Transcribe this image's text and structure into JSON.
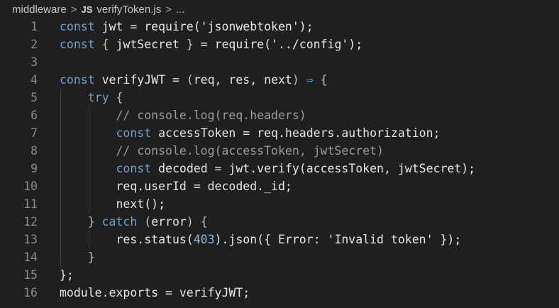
{
  "breadcrumb": {
    "folder": "middleware",
    "file_icon": "JS",
    "file": "verifyToken.js",
    "more": "..."
  },
  "colors": {
    "background": "#1f1f1f",
    "keyword": "#6fa0d0",
    "text": "#e6e6e6",
    "comment": "#9a9a9a",
    "line_number": "#8a8a8a"
  },
  "lines": [
    {
      "n": "1",
      "t": [
        [
          "const",
          "kw"
        ],
        " jwt = require('jsonwebtoken');"
      ]
    },
    {
      "n": "2",
      "t": [
        [
          "const",
          "kw"
        ],
        [
          " { ",
          "pn"
        ],
        "jwtSecret",
        [
          " }",
          "pn"
        ],
        " = require('../config');"
      ]
    },
    {
      "n": "3",
      "t": []
    },
    {
      "n": "4",
      "t": [
        [
          "const",
          "kw"
        ],
        " verifyJWT = ",
        [
          "(",
          "pn"
        ],
        "req, res, next",
        [
          ")",
          "pn"
        ],
        " ",
        [
          "⇒",
          "kw"
        ],
        [
          " {",
          "pn"
        ]
      ]
    },
    {
      "n": "5",
      "t": [
        "    ",
        [
          "try",
          "kw"
        ],
        [
          " {",
          "pn"
        ]
      ]
    },
    {
      "n": "6",
      "t": [
        [
          "        // console.log(req.headers)",
          "cm"
        ]
      ]
    },
    {
      "n": "7",
      "t": [
        "        ",
        [
          "const",
          "kw"
        ],
        " accessToken = req.headers.authorization;"
      ]
    },
    {
      "n": "8",
      "t": [
        [
          "        // console.log(accessToken, jwtSecret)",
          "cm"
        ]
      ]
    },
    {
      "n": "9",
      "t": [
        "        ",
        [
          "const",
          "kw"
        ],
        " decoded = jwt.verify(accessToken, jwtSecret);"
      ]
    },
    {
      "n": "10",
      "t": [
        "        req.userId = decoded._id;"
      ]
    },
    {
      "n": "11",
      "t": [
        "        next();"
      ]
    },
    {
      "n": "12",
      "t": [
        [
          "    }",
          "pn"
        ],
        " ",
        [
          "catch",
          "kw"
        ],
        " ",
        [
          "(",
          "pn"
        ],
        "error",
        [
          ")",
          "pn"
        ],
        [
          " {",
          "pn"
        ]
      ]
    },
    {
      "n": "13",
      "t": [
        "        res.status(",
        [
          "403",
          "num"
        ],
        ").json({ Error: 'Invalid token' });"
      ]
    },
    {
      "n": "14",
      "t": [
        [
          "    }",
          "pn"
        ]
      ]
    },
    {
      "n": "15",
      "t": [
        "};"
      ]
    },
    {
      "n": "16",
      "t": [
        "module.exports = verifyJWT;"
      ]
    }
  ]
}
